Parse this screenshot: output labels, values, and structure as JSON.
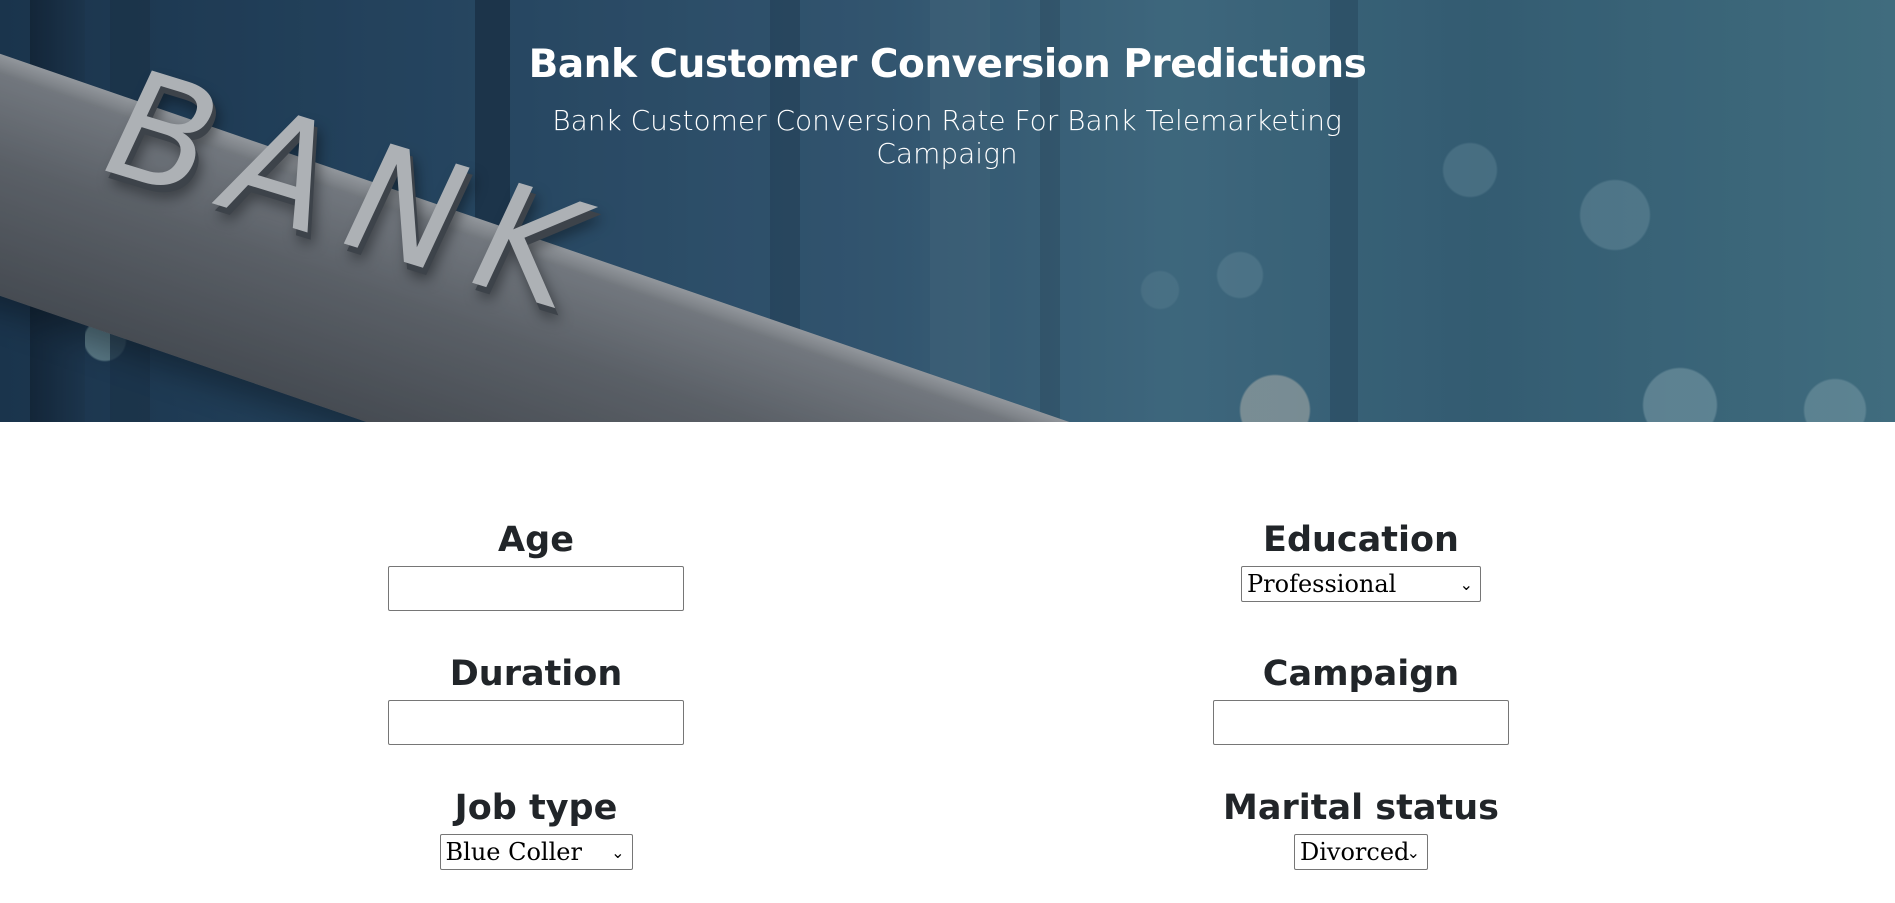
{
  "header": {
    "title": "Bank Customer Conversion Predictions",
    "subtitle": "Bank Customer Conversion Rate For Bank Telemarketing Campaign",
    "image_text": "BANK"
  },
  "form": {
    "age": {
      "label": "Age",
      "value": ""
    },
    "education": {
      "label": "Education",
      "selected": "Professional"
    },
    "duration": {
      "label": "Duration",
      "value": ""
    },
    "campaign": {
      "label": "Campaign",
      "value": ""
    },
    "job_type": {
      "label": "Job type",
      "selected": "Blue Coller"
    },
    "marital_status": {
      "label": "Marital status",
      "selected": "Divorced"
    }
  }
}
